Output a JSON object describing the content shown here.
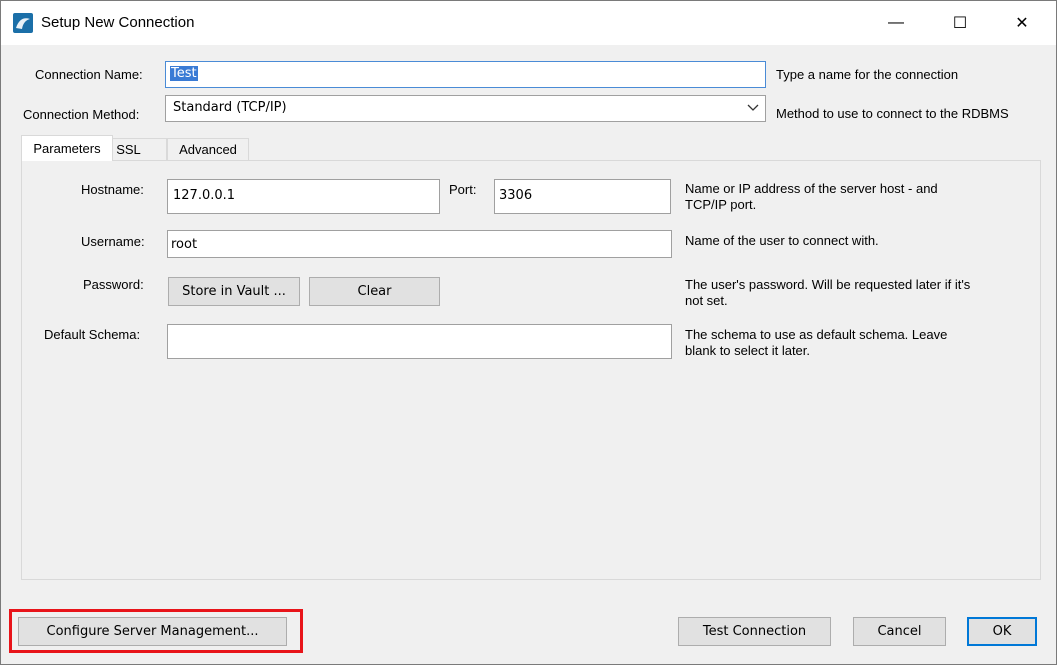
{
  "window": {
    "title": "Setup New Connection",
    "minimize_glyph": "—",
    "maximize_glyph": "☐",
    "close_glyph": "✕"
  },
  "connection_name": {
    "label": "Connection Name:",
    "value": "Test",
    "hint": "Type a name for the connection"
  },
  "connection_method": {
    "label": "Connection Method:",
    "value": "Standard (TCP/IP)",
    "hint": "Method to use to connect to the RDBMS"
  },
  "tabs": [
    {
      "label": "Parameters",
      "active": true
    },
    {
      "label": "SSL",
      "active": false
    },
    {
      "label": "Advanced",
      "active": false
    }
  ],
  "parameters": {
    "hostname": {
      "label": "Hostname:",
      "value": "127.0.0.1"
    },
    "port": {
      "label": "Port:",
      "value": "3306"
    },
    "hostname_hint_1": "Name or IP address of the server host - and",
    "hostname_hint_2": "TCP/IP port.",
    "username": {
      "label": "Username:",
      "value": "root",
      "hint": "Name of the user to connect with."
    },
    "password": {
      "label": "Password:",
      "store_button": "Store in Vault ...",
      "clear_button": "Clear",
      "hint_1": "The user's password. Will be requested later if it's",
      "hint_2": "not set."
    },
    "default_schema": {
      "label": "Default Schema:",
      "value": "",
      "hint_1": "The schema to use as default schema. Leave",
      "hint_2": "blank to select it later."
    }
  },
  "footer": {
    "configure_button": "Configure Server Management...",
    "test_button": "Test Connection",
    "cancel_button": "Cancel",
    "ok_button": "OK"
  },
  "colors": {
    "highlight": "#e8141a",
    "selection": "#3a7bd5",
    "ok_border": "#0078d7"
  },
  "icons": {
    "app": "mysql-workbench-icon",
    "dropdown": "chevron-down-icon"
  }
}
